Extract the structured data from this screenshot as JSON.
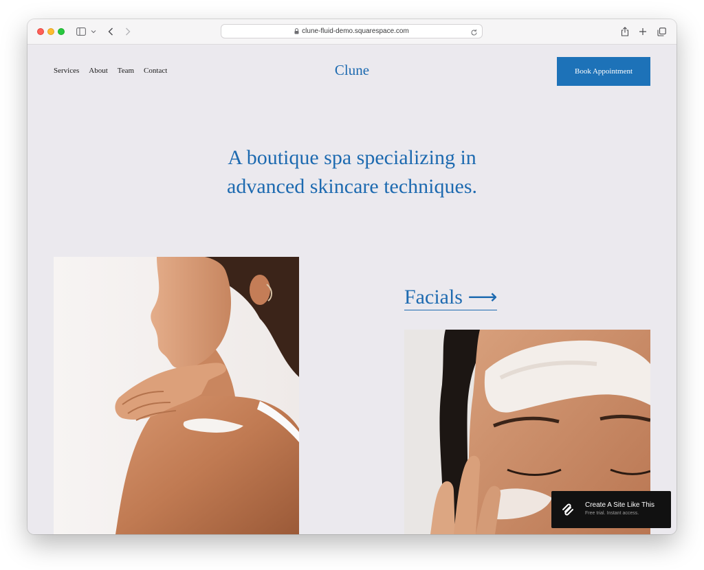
{
  "browser": {
    "url": "clune-fluid-demo.squarespace.com",
    "icons": {
      "sidebar": "sidebar-icon",
      "chevron": "chevron-down-icon",
      "back": "back-arrow-icon",
      "forward": "forward-arrow-icon",
      "lock": "lock-icon",
      "reload": "reload-icon",
      "share": "share-icon",
      "new_tab": "plus-icon",
      "tabs": "tabs-overview-icon"
    }
  },
  "header": {
    "nav": [
      "Services",
      "About",
      "Team",
      "Contact"
    ],
    "logo": "Clune",
    "cta": "Book Appointment"
  },
  "hero": {
    "line1": "A boutique spa specializing in",
    "line2": "advanced skincare techniques."
  },
  "services": {
    "link": "Facials ⟶"
  },
  "badge": {
    "title": "Create A Site Like This",
    "subtitle": "Free trial. Instant access.",
    "icon": "squarespace-logo-icon"
  },
  "colors": {
    "accent": "#1d6ab0",
    "button": "#1d72b8",
    "page_background": "#ebe9ee",
    "badge_background": "#111111"
  }
}
